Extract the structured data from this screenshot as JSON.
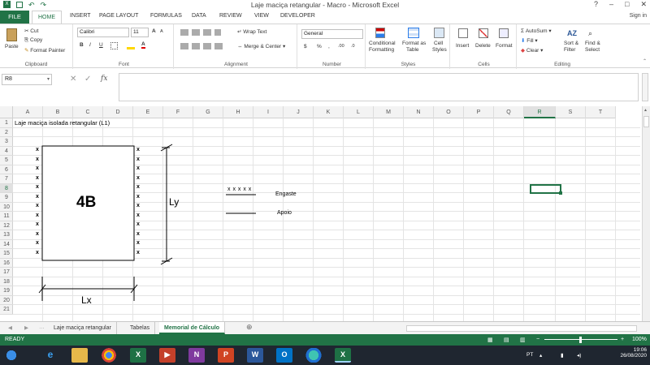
{
  "window": {
    "title": "Laje maciça retangular - Macro - Microsoft Excel",
    "controls": [
      "?",
      "–",
      "□",
      "✕"
    ]
  },
  "ribbon_tabs": [
    "FILE",
    "HOME",
    "INSERT",
    "PAGE LAYOUT",
    "FORMULAS",
    "DATA",
    "REVIEW",
    "VIEW",
    "DEVELOPER"
  ],
  "sign_in": "Sign in",
  "clipboard": {
    "paste": "Paste",
    "cut": "Cut",
    "copy": "Copy",
    "format_painter": "Format Painter",
    "label": "Clipboard"
  },
  "font": {
    "name": "Calibri",
    "size": "11",
    "bold": "B",
    "italic": "I",
    "underline": "U",
    "grow": "A",
    "shrink": "A",
    "color": "A",
    "label": "Font"
  },
  "alignment": {
    "wrap": "Wrap Text",
    "merge": "Merge & Center",
    "label": "Alignment"
  },
  "number": {
    "format": "General",
    "currency": "$",
    "percent": "%",
    "comma": ",",
    "inc_dec": ".00",
    "dec_dec": ".0",
    "label": "Number"
  },
  "styles": {
    "conditional": "Conditional",
    "conditional2": "Formatting",
    "format_table": "Format as",
    "format_table2": "Table",
    "cell_styles": "Cell",
    "cell_styles2": "Styles",
    "label": "Styles"
  },
  "cells_group": {
    "insert": "Insert",
    "delete": "Delete",
    "format": "Format",
    "label": "Cells"
  },
  "editing": {
    "autosum": "AutoSum",
    "fill": "Fill",
    "clear": "Clear",
    "sort": "Sort &",
    "sort2": "Filter",
    "find": "Find &",
    "find2": "Select",
    "label": "Editing"
  },
  "formula_bar": {
    "name_box": "R8",
    "fx": "fx",
    "content": ""
  },
  "columns": [
    "A",
    "B",
    "C",
    "D",
    "E",
    "F",
    "G",
    "H",
    "I",
    "J",
    "K",
    "L",
    "M",
    "N",
    "O",
    "P",
    "Q",
    "R",
    "S",
    "T"
  ],
  "rows": [
    "1",
    "2",
    "3",
    "4",
    "5",
    "6",
    "7",
    "8",
    "9",
    "10",
    "11",
    "12",
    "13",
    "14",
    "15",
    "16",
    "17",
    "18",
    "19",
    "20",
    "21"
  ],
  "sheet": {
    "title_cell": "Laje maciça isolada retangular (L1)",
    "slab_label": "4B",
    "lx": "Lx",
    "ly": "Ly",
    "x_mark": "x",
    "legend_x": "x x x x x",
    "engaste": "Engaste",
    "apoio": "Apoio"
  },
  "sheet_tabs": [
    "Laje maciça retangular",
    "Tabelas",
    "Memorial de Cálculo"
  ],
  "status": {
    "ready": "READY",
    "zoom": "100%"
  },
  "taskbar": {
    "lang": "PT",
    "time": "19:06",
    "date": "26/08/2020"
  },
  "colors": {
    "excel_green": "#217346",
    "taskbar": "#1f2630"
  }
}
